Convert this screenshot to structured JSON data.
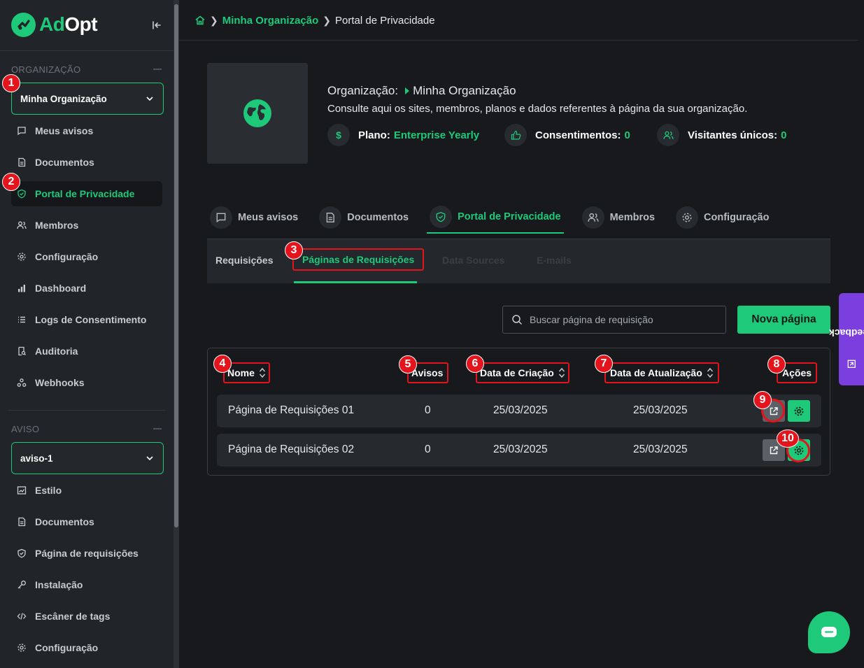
{
  "brand": {
    "name_a": "Ad",
    "name_b": "Opt"
  },
  "sidebar": {
    "org_section": "ORGANIZAÇÃO",
    "org_select": "Minha Organização",
    "org_items": [
      {
        "label": "Meus avisos",
        "icon": "message-icon"
      },
      {
        "label": "Documentos",
        "icon": "document-icon"
      },
      {
        "label": "Portal de Privacidade",
        "icon": "shield-icon"
      },
      {
        "label": "Membros",
        "icon": "users-icon"
      },
      {
        "label": "Configuração",
        "icon": "gear-icon"
      },
      {
        "label": "Dashboard",
        "icon": "bar-chart-icon"
      },
      {
        "label": "Logs de Consentimento",
        "icon": "list-icon"
      },
      {
        "label": "Auditoria",
        "icon": "audit-icon"
      },
      {
        "label": "Webhooks",
        "icon": "webhook-icon"
      }
    ],
    "notice_section": "AVISO",
    "notice_select": "aviso-1",
    "notice_items": [
      {
        "label": "Estilo",
        "icon": "style-icon"
      },
      {
        "label": "Documentos",
        "icon": "document-icon"
      },
      {
        "label": "Página de requisições",
        "icon": "shield-icon"
      },
      {
        "label": "Instalação",
        "icon": "key-icon"
      },
      {
        "label": "Escâner de tags",
        "icon": "code-icon"
      },
      {
        "label": "Configuração",
        "icon": "gear-icon"
      }
    ]
  },
  "breadcrumb": {
    "org": "Minha Organização",
    "current": "Portal de Privacidade"
  },
  "org": {
    "title_label": "Organização:",
    "title_name": "Minha Organização",
    "description": "Consulte aqui os sites, membros, planos e dados referentes à página da sua organização.",
    "plan_label": "Plano:",
    "plan_value": "Enterprise Yearly",
    "consents_label": "Consentimentos:",
    "consents_value": "0",
    "visitors_label": "Visitantes únicos:",
    "visitors_value": "0"
  },
  "tabs": [
    "Meus avisos",
    "Documentos",
    "Portal de Privacidade",
    "Membros",
    "Configuração"
  ],
  "subtabs": [
    "Requisições",
    "Páginas de Requisições",
    "Data Sources",
    "E-mails"
  ],
  "search": {
    "placeholder": "Buscar página de requisição"
  },
  "new_button": "Nova página",
  "table": {
    "headers": [
      "Nome",
      "Avisos",
      "Data de Criação",
      "Data de Atualização",
      "Ações"
    ],
    "rows": [
      {
        "name": "Página de Requisições 01",
        "notices": "0",
        "created": "25/03/2025",
        "updated": "25/03/2025"
      },
      {
        "name": "Página de Requisições 02",
        "notices": "0",
        "created": "25/03/2025",
        "updated": "25/03/2025"
      }
    ]
  },
  "annotations": [
    "1",
    "2",
    "3",
    "4",
    "5",
    "6",
    "7",
    "8",
    "9",
    "10"
  ],
  "feedback": "Feedback",
  "colors": {
    "accent": "#1ec97a",
    "annotation": "#e3141c",
    "feedback": "#7b3fe0"
  }
}
